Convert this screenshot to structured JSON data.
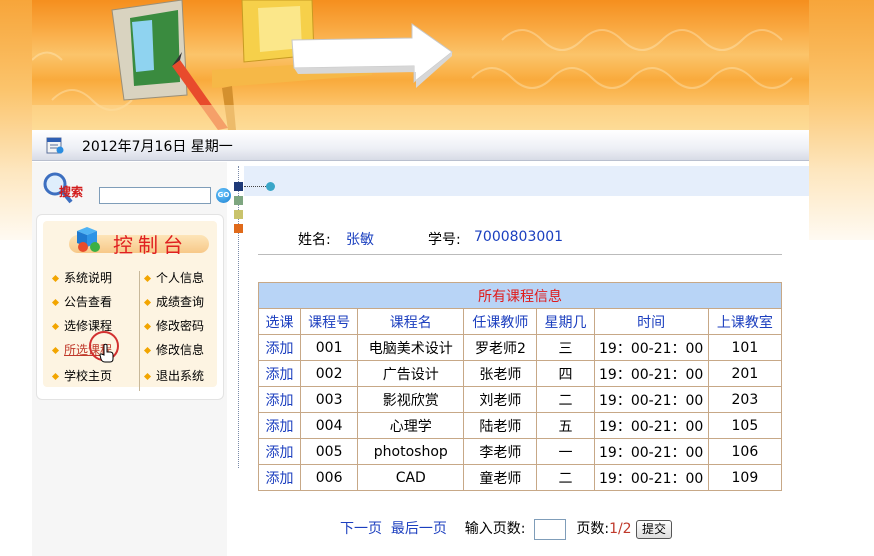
{
  "date_bar": {
    "date_text": "2012年7月16日  星期一"
  },
  "search": {
    "label": "搜索",
    "placeholder": "",
    "go_label": "GO"
  },
  "control_panel": {
    "title": "控制台",
    "left_menu": [
      "系统说明",
      "公告查看",
      "选修课程",
      "所选课程",
      "学校主页"
    ],
    "right_menu": [
      "个人信息",
      "成绩查询",
      "修改密码",
      "修改信息",
      "退出系统"
    ]
  },
  "student": {
    "name_label": "姓名:",
    "name_value": "张敏",
    "id_label": "学号:",
    "id_value": "7000803001"
  },
  "table": {
    "caption": "所有课程信息",
    "headers": [
      "选课",
      "课程号",
      "课程名",
      "任课教师",
      "星期几",
      "时间",
      "上课教室"
    ],
    "rows": [
      [
        "添加",
        "001",
        "电脑美术设计",
        "罗老师2",
        "三",
        "19：00-21：00",
        "101"
      ],
      [
        "添加",
        "002",
        "广告设计",
        "张老师",
        "四",
        "19：00-21：00",
        "201"
      ],
      [
        "添加",
        "003",
        "影视欣赏",
        "刘老师",
        "二",
        "19：00-21：00",
        "203"
      ],
      [
        "添加",
        "004",
        "心理学",
        "陆老师",
        "五",
        "19：00-21：00",
        "105"
      ],
      [
        "添加",
        "005",
        "photoshop",
        "李老师",
        "一",
        "19：00-21：00",
        "106"
      ],
      [
        "添加",
        "006",
        "CAD",
        "童老师",
        "二",
        "19：00-21：00",
        "109"
      ]
    ]
  },
  "pager": {
    "next": "下一页",
    "last": "最后一页",
    "input_label": "输入页数:",
    "pages_label": "页数:",
    "pages_value": "1/2",
    "submit": "提交"
  },
  "colors": {
    "banner_orange": "#f7a53a",
    "table_header_bg": "#b8d4f6",
    "link_blue": "#1c3fbf",
    "caption_red": "#e01b1b"
  }
}
